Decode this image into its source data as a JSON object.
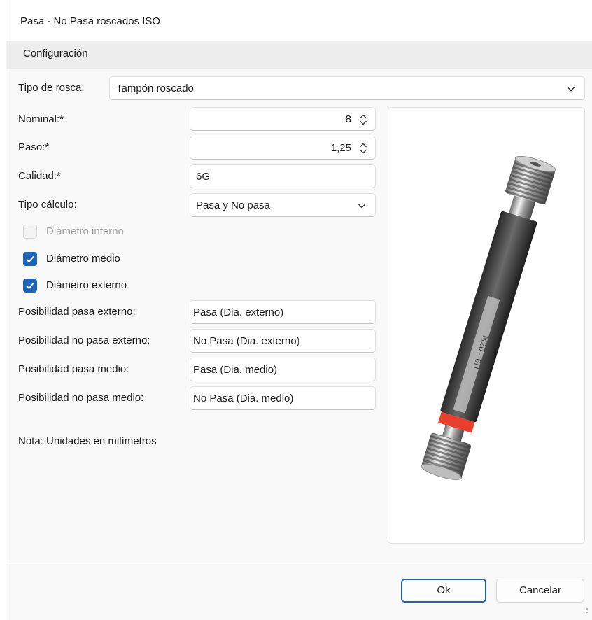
{
  "window": {
    "title": "Pasa - No Pasa roscados ISO"
  },
  "section": {
    "header": "Configuración"
  },
  "form": {
    "tipo_rosca": {
      "label": "Tipo de rosca:",
      "value": "Tampón roscado"
    },
    "nominal": {
      "label": "Nominal:*",
      "value": "8"
    },
    "paso": {
      "label": "Paso:*",
      "value": "1,25"
    },
    "calidad": {
      "label": "Calidad:*",
      "value": "6G"
    },
    "tipo_calculo": {
      "label": "Tipo cálculo:",
      "value": "Pasa y No pasa"
    },
    "diametro_interno": {
      "label": "Diámetro interno",
      "checked": false,
      "disabled": true
    },
    "diametro_medio": {
      "label": "Diámetro medio",
      "checked": true
    },
    "diametro_externo": {
      "label": "Diámetro externo",
      "checked": true
    },
    "pasa_externo": {
      "label": "Posibilidad pasa externo:",
      "value": "Pasa (Dia. externo)"
    },
    "no_pasa_externo": {
      "label": "Posibilidad no pasa externo:",
      "value": "No Pasa (Dia. externo)"
    },
    "pasa_medio": {
      "label": "Posibilidad pasa medio:",
      "value": "Pasa (Dia. medio)"
    },
    "no_pasa_medio": {
      "label": "Posibilidad no pasa medio:",
      "value": "No Pasa (Dia. medio)"
    },
    "nota": "Nota: Unidades en milímetros"
  },
  "image": {
    "engraving": "M20 - 6H"
  },
  "buttons": {
    "ok": "Ok",
    "cancel": "Cancelar"
  },
  "colors": {
    "accent": "#1c64b8",
    "gauge_ring": "#e8402c"
  }
}
